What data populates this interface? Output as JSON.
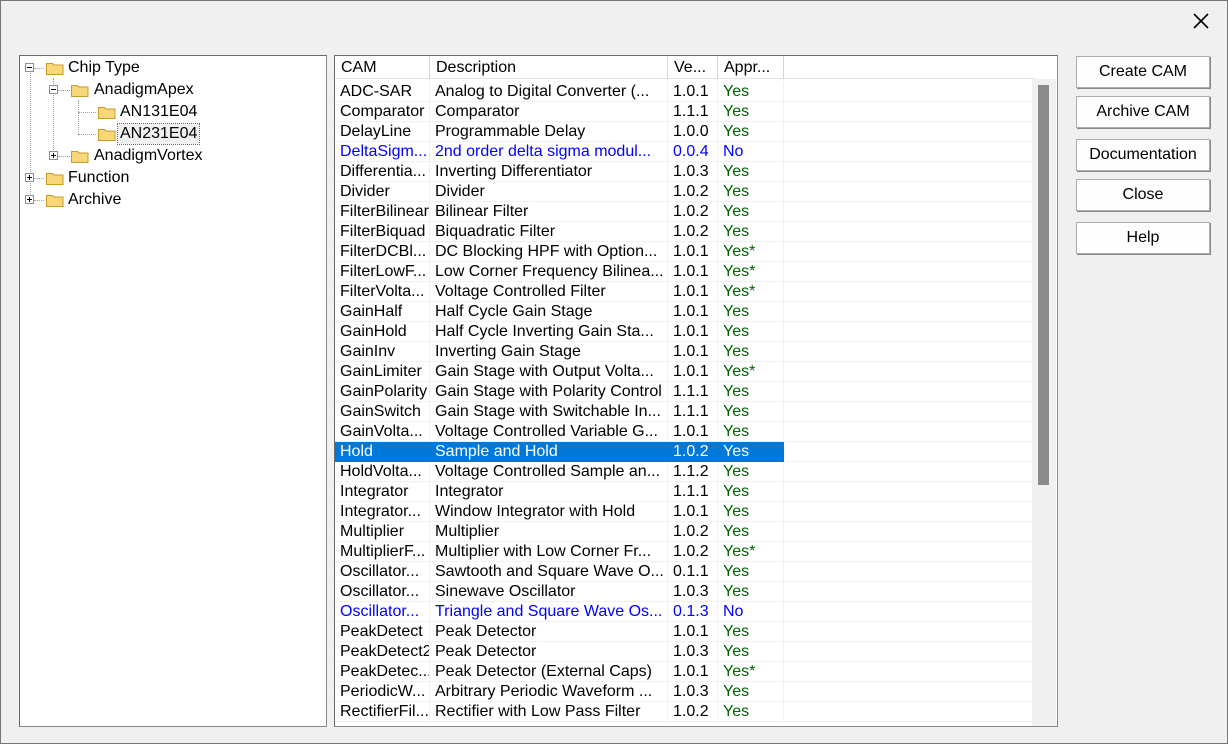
{
  "tree": {
    "nodes": [
      {
        "label": "Chip Type",
        "expanded": true
      },
      {
        "label": "AnadigmApex",
        "expanded": true
      },
      {
        "label": "AN131E04"
      },
      {
        "label": "AN231E04",
        "selected": true
      },
      {
        "label": "AnadigmVortex",
        "expanded": false
      },
      {
        "label": "Function",
        "expanded": false
      },
      {
        "label": "Archive",
        "expanded": false
      }
    ]
  },
  "list": {
    "headers": [
      "CAM",
      "Description",
      "Ve...",
      "Appr..."
    ],
    "rows": [
      [
        "ADC-SAR",
        "Analog to Digital Converter (...",
        "1.0.1",
        "Yes"
      ],
      [
        "Comparator",
        "Comparator",
        "1.1.1",
        "Yes"
      ],
      [
        "DelayLine",
        "Programmable Delay",
        "1.0.0",
        "Yes"
      ],
      [
        "DeltaSigm...",
        "2nd order delta sigma modul...",
        "0.0.4",
        "No"
      ],
      [
        "Differentia...",
        "Inverting Differentiator",
        "1.0.3",
        "Yes"
      ],
      [
        "Divider",
        "Divider",
        "1.0.2",
        "Yes"
      ],
      [
        "FilterBilinear",
        "Bilinear Filter",
        "1.0.2",
        "Yes"
      ],
      [
        "FilterBiquad",
        "Biquadratic Filter",
        "1.0.2",
        "Yes"
      ],
      [
        "FilterDCBl...",
        "DC Blocking HPF with Option...",
        "1.0.1",
        "Yes*"
      ],
      [
        "FilterLowF...",
        "Low Corner Frequency Bilinea...",
        "1.0.1",
        "Yes*"
      ],
      [
        "FilterVolta...",
        "Voltage Controlled Filter",
        "1.0.1",
        "Yes*"
      ],
      [
        "GainHalf",
        "Half Cycle Gain Stage",
        "1.0.1",
        "Yes"
      ],
      [
        "GainHold",
        "Half Cycle Inverting Gain Sta...",
        "1.0.1",
        "Yes"
      ],
      [
        "GainInv",
        "Inverting Gain Stage",
        "1.0.1",
        "Yes"
      ],
      [
        "GainLimiter",
        "Gain Stage with Output Volta...",
        "1.0.1",
        "Yes*"
      ],
      [
        "GainPolarity",
        "Gain Stage with Polarity Control",
        "1.1.1",
        "Yes"
      ],
      [
        "GainSwitch",
        "Gain Stage with Switchable In...",
        "1.1.1",
        "Yes"
      ],
      [
        "GainVolta...",
        "Voltage Controlled Variable G...",
        "1.0.1",
        "Yes"
      ],
      [
        "Hold",
        "Sample and Hold",
        "1.0.2",
        "Yes"
      ],
      [
        "HoldVolta...",
        "Voltage Controlled Sample an...",
        "1.1.2",
        "Yes"
      ],
      [
        "Integrator",
        "Integrator",
        "1.1.1",
        "Yes"
      ],
      [
        "Integrator...",
        "Window Integrator with Hold",
        "1.0.1",
        "Yes"
      ],
      [
        "Multiplier",
        "Multiplier",
        "1.0.2",
        "Yes"
      ],
      [
        "MultiplierF...",
        "Multiplier with Low Corner Fr...",
        "1.0.2",
        "Yes*"
      ],
      [
        "Oscillator...",
        "Sawtooth and Square Wave O...",
        "0.1.1",
        "Yes"
      ],
      [
        "Oscillator...",
        "Sinewave Oscillator",
        "1.0.3",
        "Yes"
      ],
      [
        "Oscillator...",
        "Triangle and Square Wave Os...",
        "0.1.3",
        "No"
      ],
      [
        "PeakDetect",
        "Peak Detector",
        "1.0.1",
        "Yes"
      ],
      [
        "PeakDetect2",
        "Peak Detector",
        "1.0.3",
        "Yes"
      ],
      [
        "PeakDetec...",
        "Peak Detector (External Caps)",
        "1.0.1",
        "Yes*"
      ],
      [
        "PeriodicW...",
        "Arbitrary Periodic Waveform ...",
        "1.0.3",
        "Yes"
      ],
      [
        "RectifierFil...",
        "Rectifier with Low Pass Filter",
        "1.0.2",
        "Yes"
      ]
    ],
    "selected_index": 18,
    "unapproved_color": "#0000ff",
    "approved_color": "#006400",
    "selection_color": "#0078d7"
  },
  "buttons": {
    "create_cam": "Create CAM",
    "archive_cam": "Archive CAM",
    "documentation": "Documentation",
    "close": "Close",
    "help": "Help"
  }
}
